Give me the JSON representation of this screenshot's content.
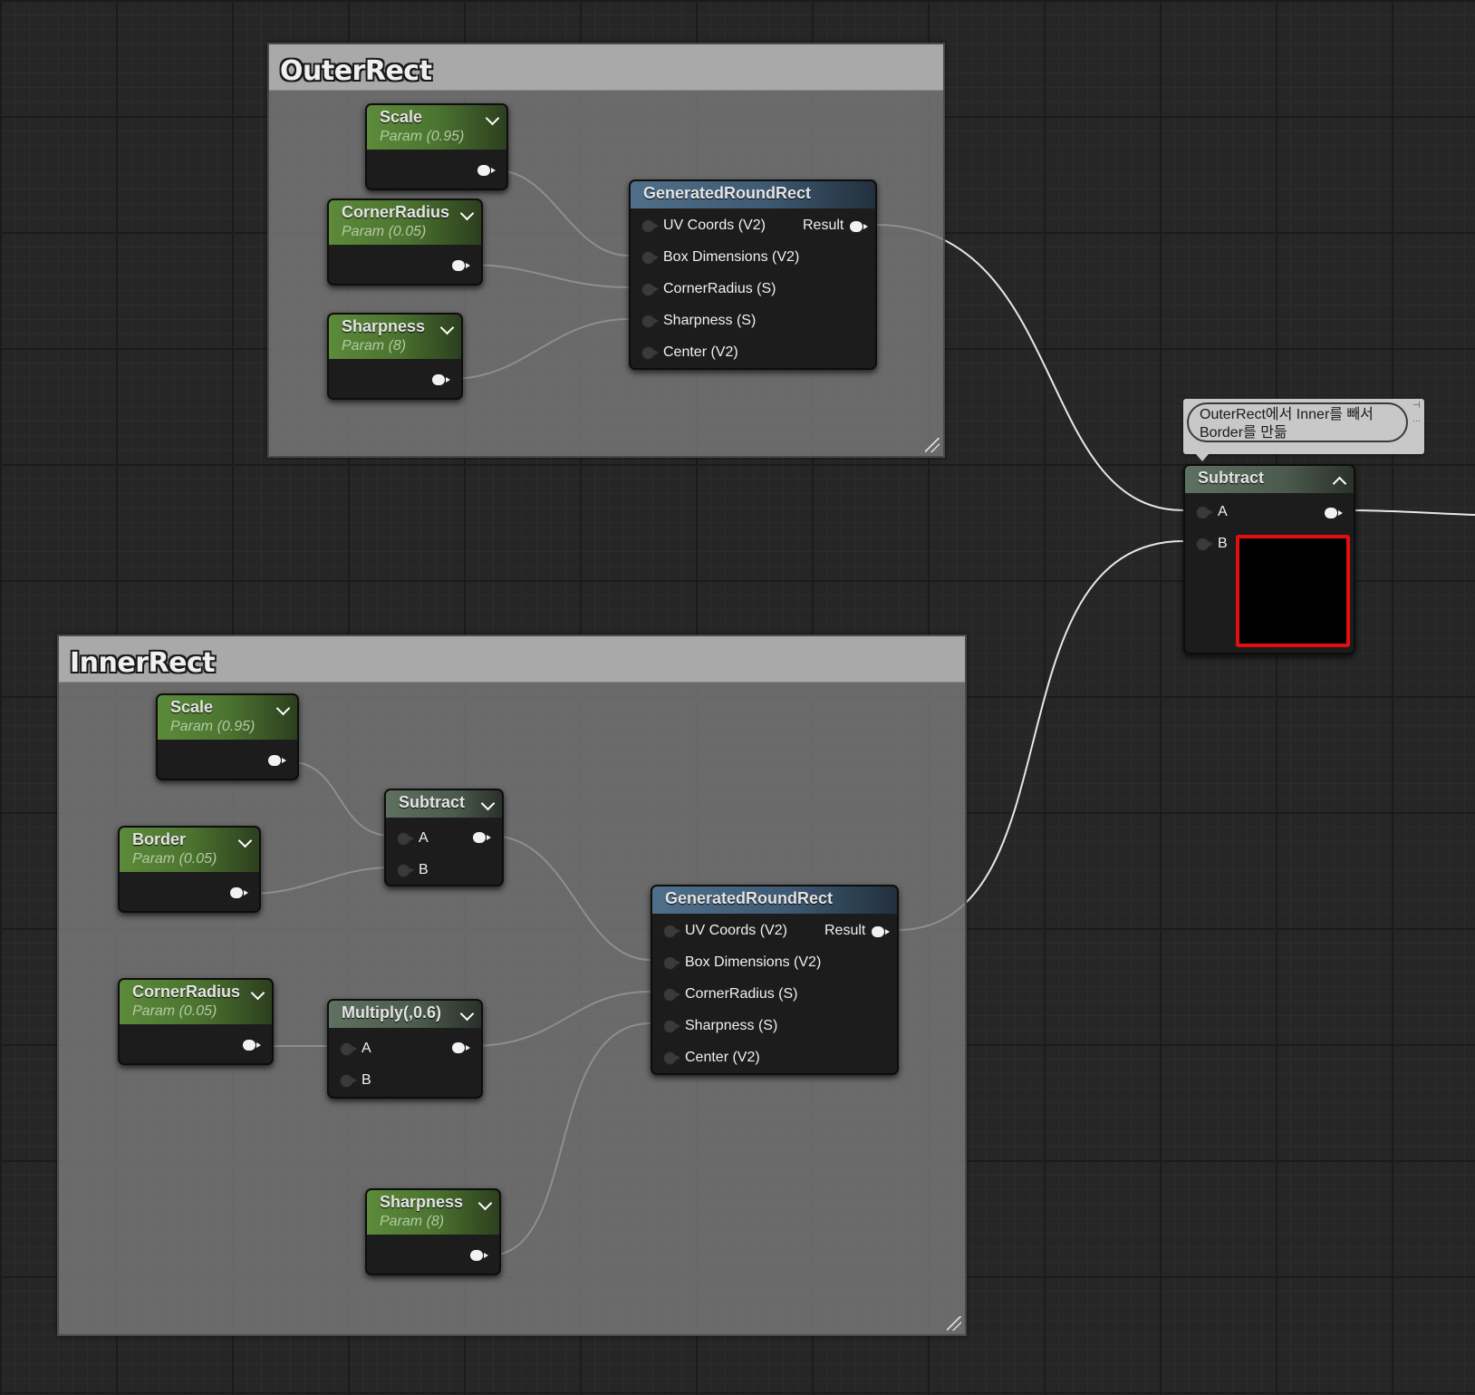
{
  "comments": {
    "outer": "OuterRect",
    "inner": "InnerRect"
  },
  "outer": {
    "scale": {
      "title": "Scale",
      "sub": "Param (0.95)"
    },
    "corner": {
      "title": "CornerRadius",
      "sub": "Param (0.05)"
    },
    "sharp": {
      "title": "Sharpness",
      "sub": "Param (8)"
    },
    "grr": {
      "title": "GeneratedRoundRect",
      "pins": [
        "UV Coords (V2)",
        "Box Dimensions (V2)",
        "CornerRadius (S)",
        "Sharpness (S)",
        "Center (V2)"
      ],
      "result": "Result"
    }
  },
  "inner": {
    "scale": {
      "title": "Scale",
      "sub": "Param (0.95)"
    },
    "border": {
      "title": "Border",
      "sub": "Param (0.05)"
    },
    "subtract": {
      "title": "Subtract",
      "a": "A",
      "b": "B"
    },
    "corner": {
      "title": "CornerRadius",
      "sub": "Param (0.05)"
    },
    "multiply": {
      "title": "Multiply(,0.6)",
      "a": "A",
      "b": "B"
    },
    "sharp": {
      "title": "Sharpness",
      "sub": "Param (8)"
    },
    "grr": {
      "title": "GeneratedRoundRect",
      "pins": [
        "UV Coords (V2)",
        "Box Dimensions (V2)",
        "CornerRadius (S)",
        "Sharpness (S)",
        "Center (V2)"
      ],
      "result": "Result"
    }
  },
  "final": {
    "title": "Subtract",
    "a": "A",
    "b": "B",
    "bubble_line1": "OuterRect에서 Inner를 빼서",
    "bubble_line2": "Border를 만듦"
  },
  "colors": {
    "wire": "#e8e8e8",
    "param_header": "#5c8a3a",
    "function_header": "#4f6f8a",
    "preview_border": "#e01010"
  }
}
